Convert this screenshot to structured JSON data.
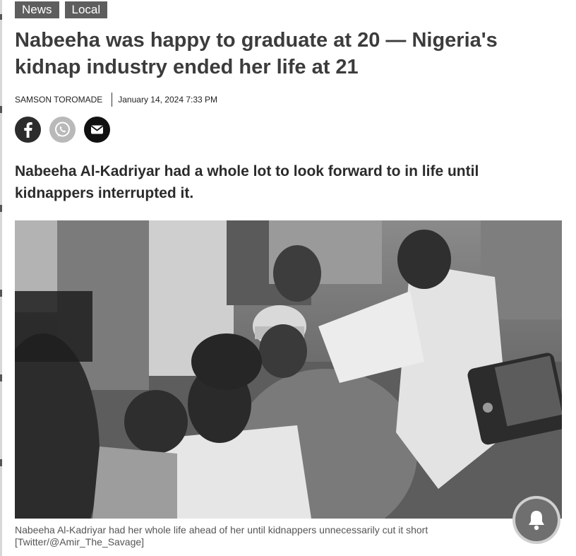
{
  "tags": [
    "News",
    "Local"
  ],
  "headline": "Nabeeha was happy to graduate at 20 — Nigeria's kidnap industry ended her life at 21",
  "byline": {
    "author": "SAMSON TOROMADE",
    "date": "January 14, 2024 7:33 PM"
  },
  "share": [
    {
      "icon": "facebook-icon"
    },
    {
      "icon": "whatsapp-icon"
    },
    {
      "icon": "email-icon"
    }
  ],
  "lede": "Nabeeha Al-Kadriyar had a whole lot to look forward to in life until kidnappers interrupted it.",
  "photo": {
    "description_hidden": ""
  },
  "caption": {
    "line1": "Nabeeha Al-Kadriyar had her whole life ahead of her until kidnappers unnecessarily cut it short",
    "line2": "[Twitter/@Amir_The_Savage]"
  },
  "notification": {
    "icon": "bell-icon"
  },
  "colors": {
    "tag_bg": "#5e5e5e",
    "headline": "#3c3c3c",
    "bell_bg": "#6f6f6f"
  }
}
